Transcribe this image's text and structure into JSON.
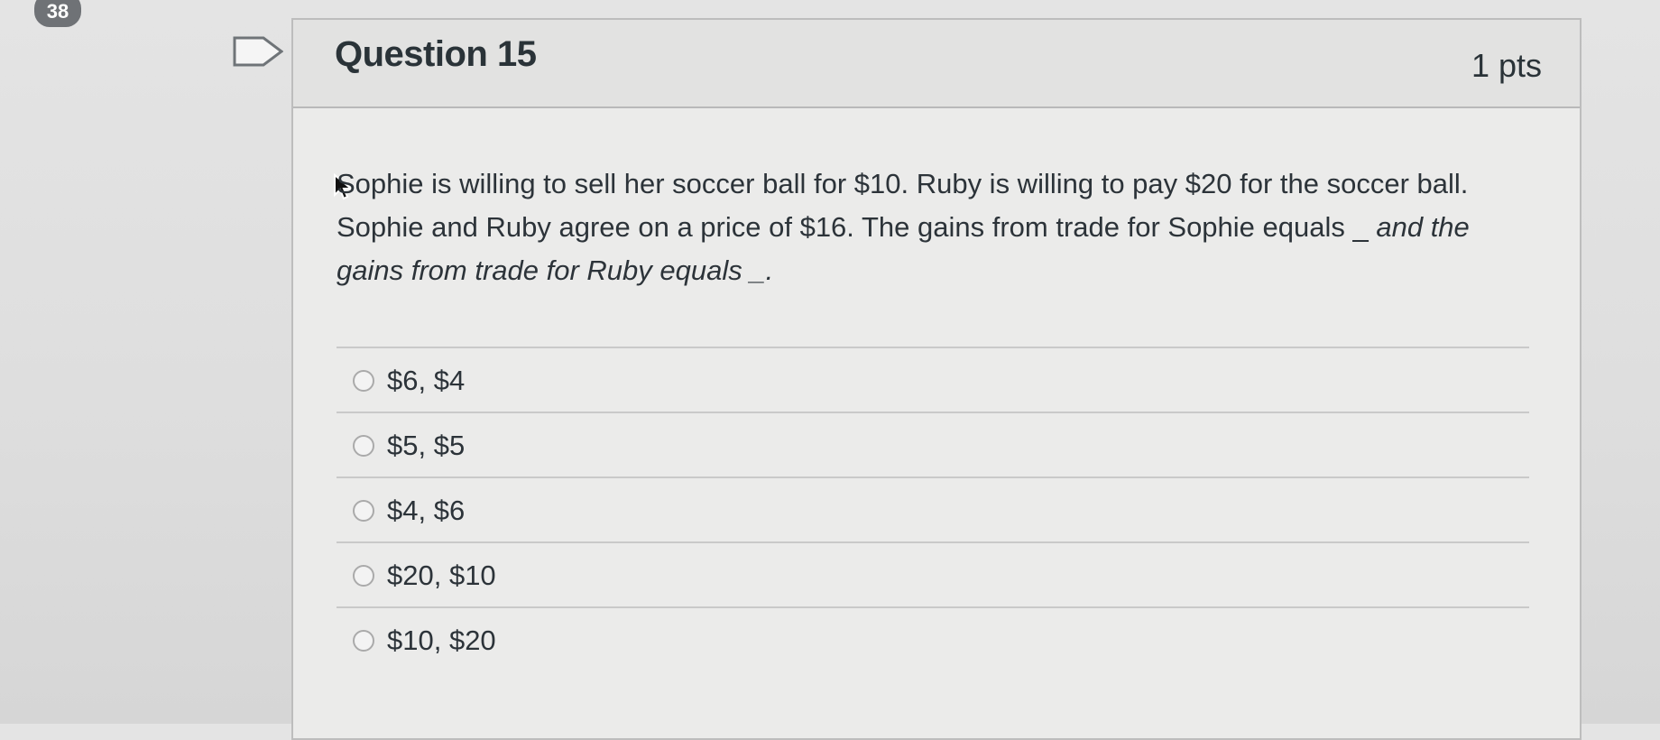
{
  "page_counter": "38",
  "question": {
    "title": "Question 15",
    "points": "1 pts",
    "text_main": "Sophie is willing to sell her soccer ball for $10. Ruby is willing to pay $20 for the soccer ball. Sophie and Ruby agree on a price of $16. The gains from trade for Sophie equals _",
    "text_italic": "and the gains from trade for Ruby equals _.",
    "answers": [
      {
        "label": "$6, $4"
      },
      {
        "label": "$5, $5"
      },
      {
        "label": "$4, $6"
      },
      {
        "label": "$20, $10"
      },
      {
        "label": "$10, $20"
      }
    ]
  },
  "icons": {
    "flag": "flag-icon",
    "cursor": "cursor-icon",
    "radio": "radio-icon"
  },
  "colors": {
    "text": "#2c3339",
    "card_bg": "#ebebea",
    "header_bg": "#e2e2e1"
  }
}
